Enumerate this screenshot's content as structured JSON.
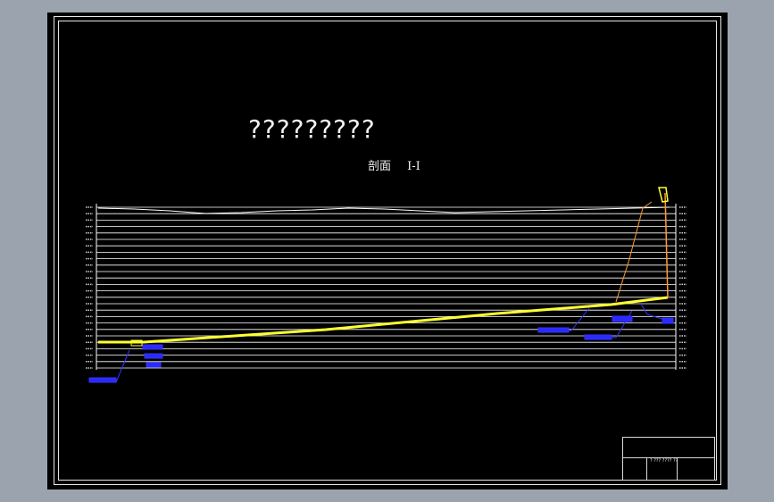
{
  "drawing": {
    "title": "?????????",
    "section_label": "剖面",
    "section_mark": "I-I",
    "title_block_text": "? ??? ???? ??"
  },
  "colors": {
    "background": "#9aa3ae",
    "sheet": "#000000",
    "lines": "#ffffff",
    "profile": "#ffff33",
    "annotation": "#1a1aff",
    "leader": "#ff9933"
  },
  "chart_data": {
    "type": "line",
    "title": "",
    "xlabel": "",
    "ylabel": "",
    "series": [
      {
        "values": [
          383,
          383,
          369,
          351,
          341,
          333
        ]
      }
    ],
    "x": [
      0,
      0.08,
      0.4,
      0.7,
      0.9,
      1.0
    ]
  }
}
